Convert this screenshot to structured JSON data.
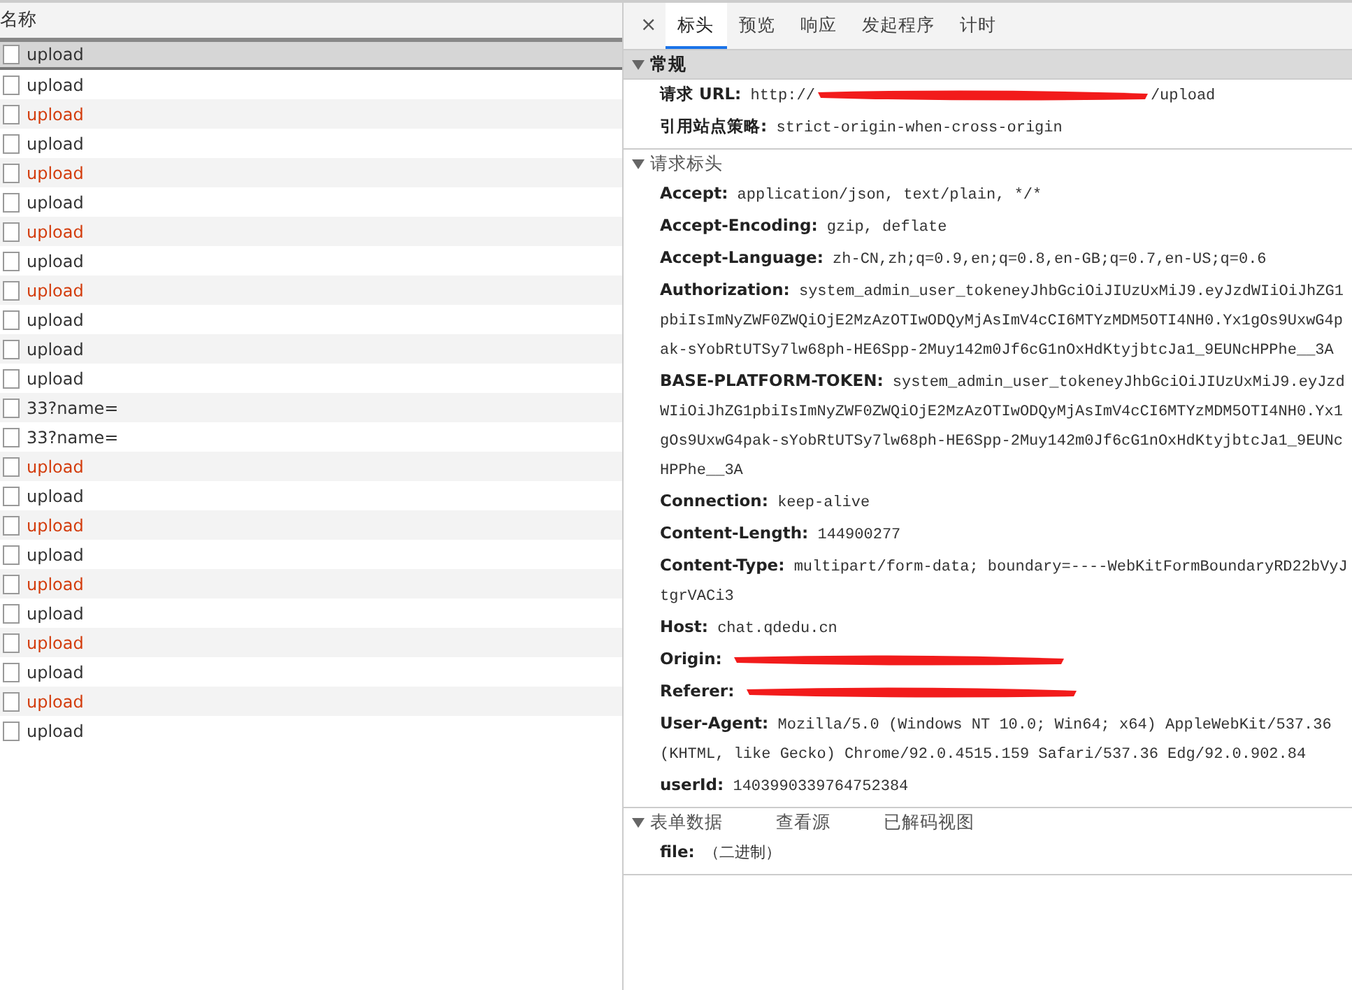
{
  "request_list": {
    "column_header": "名称",
    "rows": [
      {
        "name": "upload",
        "selected": true,
        "failed": false
      },
      {
        "name": "upload",
        "selected": false,
        "failed": false
      },
      {
        "name": "upload",
        "selected": false,
        "failed": true
      },
      {
        "name": "upload",
        "selected": false,
        "failed": false
      },
      {
        "name": "upload",
        "selected": false,
        "failed": true
      },
      {
        "name": "upload",
        "selected": false,
        "failed": false
      },
      {
        "name": "upload",
        "selected": false,
        "failed": true
      },
      {
        "name": "upload",
        "selected": false,
        "failed": false
      },
      {
        "name": "upload",
        "selected": false,
        "failed": true
      },
      {
        "name": "upload",
        "selected": false,
        "failed": false
      },
      {
        "name": "upload",
        "selected": false,
        "failed": false
      },
      {
        "name": "upload",
        "selected": false,
        "failed": false
      },
      {
        "name": "33?name=",
        "selected": false,
        "failed": false
      },
      {
        "name": "33?name=",
        "selected": false,
        "failed": false
      },
      {
        "name": "upload",
        "selected": false,
        "failed": true
      },
      {
        "name": "upload",
        "selected": false,
        "failed": false
      },
      {
        "name": "upload",
        "selected": false,
        "failed": true
      },
      {
        "name": "upload",
        "selected": false,
        "failed": false
      },
      {
        "name": "upload",
        "selected": false,
        "failed": true
      },
      {
        "name": "upload",
        "selected": false,
        "failed": false
      },
      {
        "name": "upload",
        "selected": false,
        "failed": true
      },
      {
        "name": "upload",
        "selected": false,
        "failed": false
      },
      {
        "name": "upload",
        "selected": false,
        "failed": true
      },
      {
        "name": "upload",
        "selected": false,
        "failed": false
      }
    ]
  },
  "details": {
    "close": "×",
    "tabs": [
      {
        "label": "标头",
        "selected": true
      },
      {
        "label": "预览",
        "selected": false
      },
      {
        "label": "响应",
        "selected": false
      },
      {
        "label": "发起程序",
        "selected": false
      },
      {
        "label": "计时",
        "selected": false
      }
    ],
    "sections": [
      {
        "title": "常规",
        "expanded": true,
        "highlighted": true,
        "fields": [
          {
            "label": "请求 URL:",
            "value": "http://",
            "redacted": true,
            "value_end": "/upload"
          },
          {
            "label": "引用站点策略:",
            "value": "strict-origin-when-cross-origin",
            "redacted": false
          }
        ]
      },
      {
        "title": "请求标头",
        "expanded": true,
        "highlighted": false,
        "fields": [
          {
            "label": "Accept:",
            "value": "application/json, text/plain, */*",
            "redacted": false
          },
          {
            "label": "Accept-Encoding:",
            "value": "gzip, deflate",
            "redacted": false
          },
          {
            "label": "Accept-Language:",
            "value": "zh-CN,zh;q=0.9,en;q=0.8,en-GB;q=0.7,en-US;q=0.6",
            "redacted": false
          },
          {
            "label": "Authorization:",
            "value": "system_admin_user_tokeneyJhbGciOiJIUzUxMiJ9.eyJzdWIiOiJhZG1pbiIsImNyZWF0ZWQiOjE2MzAzOTIwODQyMjAsImV4cCI6MTYzMDM5OTI4NH0.Yx1gOs9UxwG4pak-sYobRtUTSy7lw68ph-HE6Spp-2Muy142m0Jf6cG1nOxHdKtyjbtcJa1_9EUNcHPPhe__3A",
            "redacted": false
          },
          {
            "label": "BASE-PLATFORM-TOKEN:",
            "value": "system_admin_user_tokeneyJhbGciOiJIUzUxMiJ9.eyJzdWIiOiJhZG1pbiIsImNyZWF0ZWQiOjE2MzAzOTIwODQyMjAsImV4cCI6MTYzMDM5OTI4NH0.Yx1gOs9UxwG4pak-sYobRtUTSy7lw68ph-HE6Spp-2Muy142m0Jf6cG1nOxHdKtyjbtcJa1_9EUNcHPPhe__3A",
            "redacted": false
          },
          {
            "label": "Connection:",
            "value": "keep-alive",
            "redacted": false
          },
          {
            "label": "Content-Length:",
            "value": "144900277",
            "redacted": false
          },
          {
            "label": "Content-Type:",
            "value": "multipart/form-data; boundary=----WebKitFormBoundaryRD22bVyJtgrVACi3",
            "redacted": false
          },
          {
            "label": "Host:",
            "value": "chat.qdedu.cn",
            "redacted": false
          },
          {
            "label": "Origin:",
            "redacted": true
          },
          {
            "label": "Referer:",
            "redacted": true
          },
          {
            "label": "User-Agent:",
            "value": "Mozilla/5.0 (Windows NT 10.0; Win64; x64) AppleWebKit/537.36 (KHTML, like Gecko) Chrome/92.0.4515.159 Safari/537.36 Edg/92.0.902.84",
            "redacted": false
          },
          {
            "label": "userId:",
            "value": "1403990339764752384",
            "redacted": false
          }
        ]
      },
      {
        "title": "表单数据",
        "expanded": true,
        "highlighted": false,
        "links": [
          "查看源",
          "已解码视图"
        ],
        "fields": [
          {
            "label": "file:",
            "value": "（二进制）"
          }
        ]
      }
    ]
  }
}
